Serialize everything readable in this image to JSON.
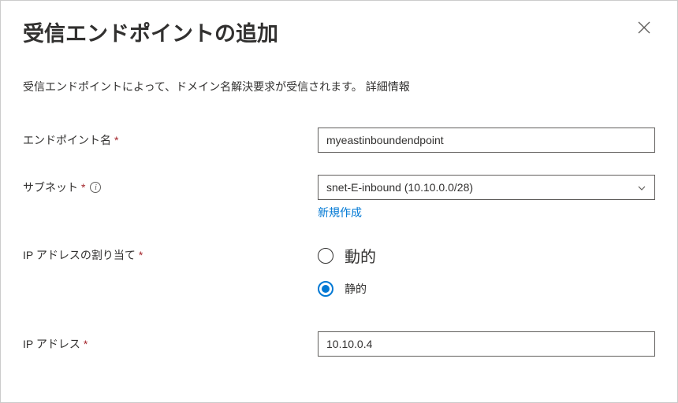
{
  "header": {
    "title": "受信エンドポイントの追加"
  },
  "description": {
    "text": "受信エンドポイントによって、ドメイン名解決要求が受信されます。",
    "learn_more": "詳細情報"
  },
  "fields": {
    "endpoint_name": {
      "label": "エンドポイント名",
      "value": "myeastinboundendpoint"
    },
    "subnet": {
      "label": "サブネット",
      "value": "snet-E-inbound (10.10.0.0/28)",
      "create_new": "新規作成"
    },
    "ip_allocation": {
      "label": "IP アドレスの割り当て",
      "options": {
        "dynamic": "動的",
        "static": "静的"
      },
      "selected": "static"
    },
    "ip_address": {
      "label": "IP アドレス",
      "value": "10.10.0.4"
    }
  }
}
